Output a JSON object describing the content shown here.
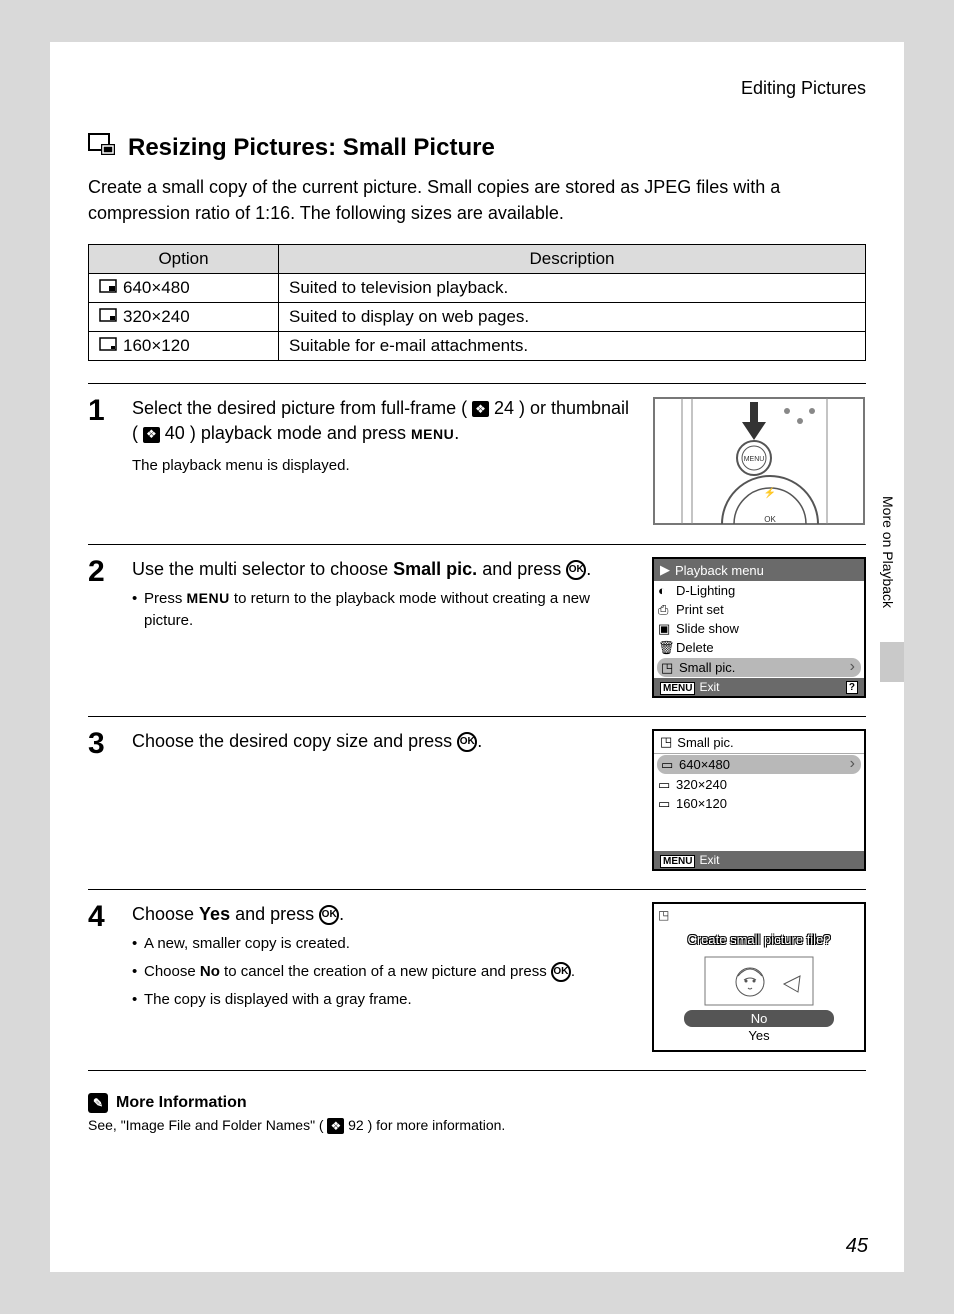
{
  "header": {
    "section": "Editing Pictures"
  },
  "title": "Resizing Pictures: Small Picture",
  "intro": "Create a small copy of the current picture. Small copies are stored as JPEG files with a compression ratio of 1:16. The following sizes are available.",
  "table": {
    "headers": {
      "option": "Option",
      "description": "Description"
    },
    "rows": [
      {
        "option": "640×480",
        "desc": "Suited to television playback."
      },
      {
        "option": "320×240",
        "desc": "Suited to display on web pages."
      },
      {
        "option": "160×120",
        "desc": "Suitable for e-mail attachments."
      }
    ]
  },
  "steps": {
    "s1": {
      "num": "1",
      "line1a": "Select the desired picture from full-frame (",
      "ref1": "24",
      "line1b": ") or thumbnail (",
      "ref2": "40",
      "line1c": ") playback mode and press ",
      "menu": "MENU",
      "line1d": ".",
      "sub": "The playback menu is displayed."
    },
    "s2": {
      "num": "2",
      "line_a": "Use the multi selector to choose ",
      "bold": "Small pic.",
      "line_b": " and press ",
      "ok": "OK",
      "line_c": ".",
      "bullet_a": "Press ",
      "bullet_menu": "MENU",
      "bullet_b": " to return to the playback mode without creating a new picture.",
      "lcd": {
        "title": "Playback menu",
        "items": [
          "D-Lighting",
          "Print set",
          "Slide show",
          "Delete",
          "Small pic."
        ],
        "exit": "Exit",
        "menu_tag": "MENU"
      }
    },
    "s3": {
      "num": "3",
      "line_a": "Choose the desired copy size and press ",
      "ok": "OK",
      "line_b": ".",
      "lcd": {
        "title": "Small pic.",
        "items": [
          "640×480",
          "320×240",
          "160×120"
        ],
        "exit": "Exit",
        "menu_tag": "MENU"
      }
    },
    "s4": {
      "num": "4",
      "line_a": "Choose ",
      "bold1": "Yes",
      "line_b": " and press ",
      "ok": "OK",
      "line_c": ".",
      "b1": "A new, smaller copy is created.",
      "b2a": "Choose ",
      "b2bold": "No",
      "b2b": " to cancel the creation of a new picture and press ",
      "b2ok": "OK",
      "b2c": ".",
      "b3": "The copy is displayed with a gray frame.",
      "lcd": {
        "question": "Create small picture file?",
        "no": "No",
        "yes": "Yes"
      }
    }
  },
  "more_info": {
    "title": "More Information",
    "body_a": "See, \"Image File and Folder Names\" (",
    "ref": "92",
    "body_b": ") for more information."
  },
  "side_tab": "More on Playback",
  "page_number": "45"
}
